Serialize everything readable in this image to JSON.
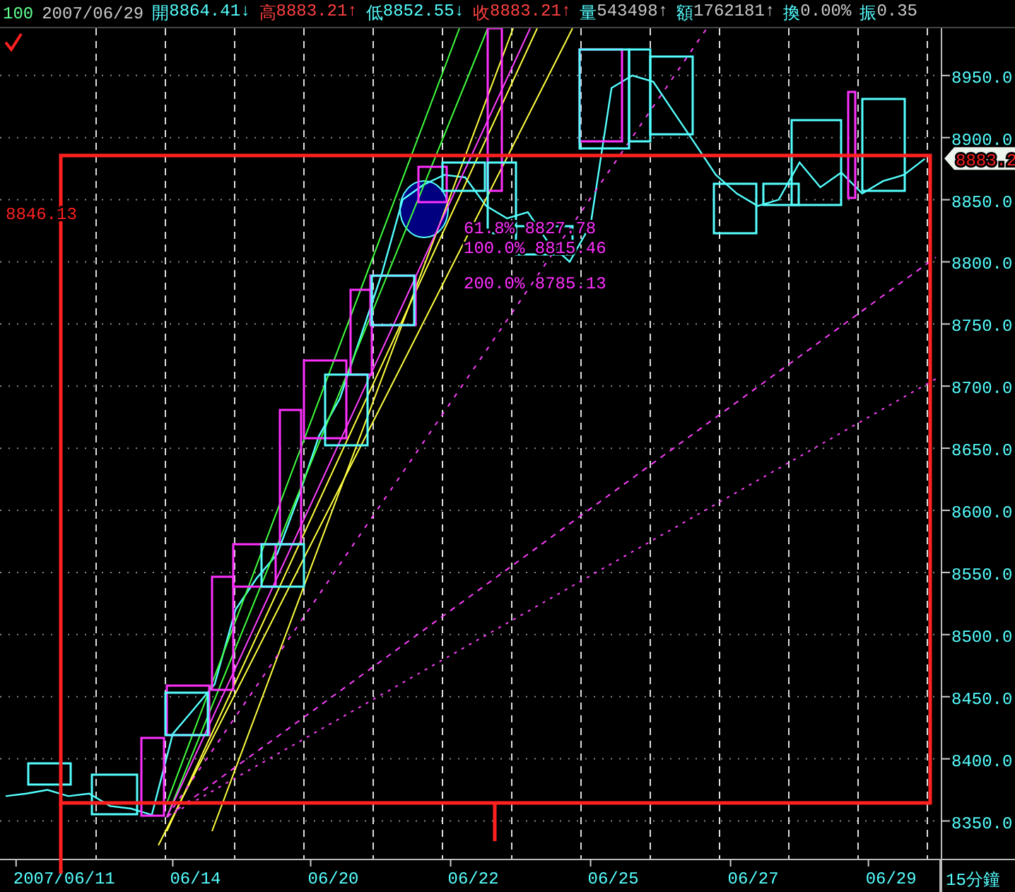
{
  "header": {
    "code": "100",
    "date": "2007/06/29",
    "quotes": [
      {
        "label": "開",
        "value": "8864.41",
        "arrow": "↓",
        "color": "#55ffff"
      },
      {
        "label": "高",
        "value": "8883.21",
        "arrow": "↑",
        "color": "#ff4040"
      },
      {
        "label": "低",
        "value": "8852.55",
        "arrow": "↓",
        "color": "#55ffff"
      },
      {
        "label": "收",
        "value": "8883.21",
        "arrow": "↑",
        "color": "#ff4040"
      },
      {
        "label": "量",
        "value": "543498",
        "arrow": "↑",
        "color": "#c8c8c8"
      },
      {
        "label": "額",
        "value": "1762181",
        "arrow": "↑",
        "color": "#c8c8c8"
      },
      {
        "label": "換",
        "value": "0.00%",
        "color": "#c8c8c8"
      },
      {
        "label": "振",
        "value": "0.35",
        "color": "#c8c8c8"
      }
    ]
  },
  "chart": {
    "left_label": "8846.13",
    "price_tag": "8883.2",
    "fib_labels": [
      {
        "text": "61.8% 8827.78"
      },
      {
        "text": "100.0% 8815.46"
      },
      {
        "text": "200.0% 8785.13"
      }
    ],
    "period": "15分鐘",
    "date_labels": [
      "2007/06/11",
      "06/14",
      "06/20",
      "06/22",
      "06/25",
      "06/27",
      "06/29"
    ],
    "chart_data": {
      "type": "line",
      "grid": true,
      "ylim": [
        8319,
        8988
      ],
      "yticks": [
        {
          "value": 8350,
          "label": "8350.0"
        },
        {
          "value": 8400,
          "label": "8400.0"
        },
        {
          "value": 8450,
          "label": "8450.0"
        },
        {
          "value": 8500,
          "label": "8500.0"
        },
        {
          "value": 8550,
          "label": "8550.0"
        },
        {
          "value": 8600,
          "label": "8600.0"
        },
        {
          "value": 8650,
          "label": "8650.0"
        },
        {
          "value": 8700,
          "label": "8700.0"
        },
        {
          "value": 8750,
          "label": "8750.0"
        },
        {
          "value": 8800,
          "label": "8800.0"
        },
        {
          "value": 8850,
          "label": "8850.0"
        },
        {
          "value": 8900,
          "label": "8900.0"
        },
        {
          "value": 8950,
          "label": "8950.0"
        }
      ],
      "series": [
        {
          "color": "#55ffff",
          "values": [
            8370,
            8372,
            8375,
            8370,
            8372,
            8362,
            8360,
            8355,
            8420,
            8440,
            8460,
            8520,
            8545,
            8565,
            8610,
            8660,
            8690,
            8740,
            8790,
            8850,
            8862,
            8870,
            8868,
            8845,
            8835,
            8840,
            8815,
            8800,
            8830,
            8940,
            8950,
            8945,
            8920,
            8895,
            8870,
            8855,
            8845,
            8850,
            8880,
            8860,
            8872,
            8855,
            8865,
            8870,
            8883
          ]
        }
      ]
    }
  }
}
